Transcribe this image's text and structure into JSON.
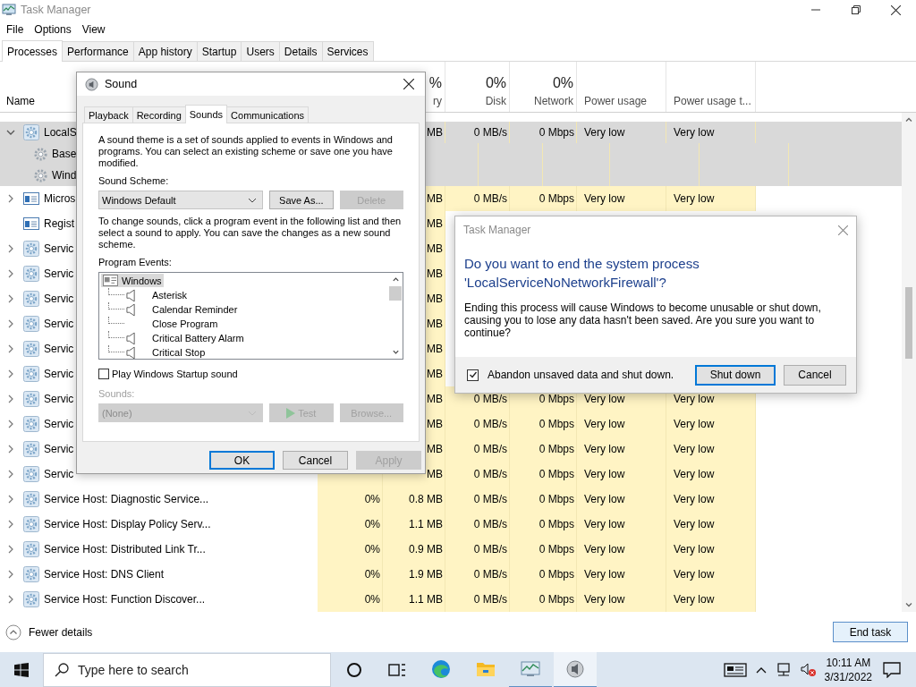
{
  "task_manager": {
    "title": "Task Manager",
    "menu": [
      "File",
      "Options",
      "View"
    ],
    "tabs": [
      {
        "label": "Processes",
        "selected": true
      },
      {
        "label": "Performance",
        "selected": false
      },
      {
        "label": "App history",
        "selected": false
      },
      {
        "label": "Startup",
        "selected": false
      },
      {
        "label": "Users",
        "selected": false
      },
      {
        "label": "Details",
        "selected": false
      },
      {
        "label": "Services",
        "selected": false
      }
    ],
    "columns": {
      "name": {
        "label": "Name"
      },
      "memory": {
        "percent": "%",
        "label": "ry"
      },
      "disk": {
        "percent": "0%",
        "label": "Disk"
      },
      "network": {
        "percent": "0%",
        "label": "Network"
      },
      "power": {
        "label": "Power usage"
      },
      "power_trend": {
        "label": "Power usage t..."
      }
    },
    "rows": [
      {
        "name": "LocalS",
        "expandable": true,
        "expanded": true,
        "kind": "service",
        "selected": true,
        "memory": "MB",
        "disk": "0 MB/s",
        "network": "0 Mbps",
        "power": "Very low",
        "power_trend": "Very low",
        "children": [
          {
            "name": "Base",
            "selected": false
          },
          {
            "name": "Wind",
            "selected": false
          }
        ]
      },
      {
        "name": "Micros",
        "expandable": true,
        "expanded": false,
        "kind": "app",
        "selected": false,
        "memory": "MB",
        "disk": "0 MB/s",
        "network": "0 Mbps",
        "power": "Very low",
        "power_trend": "Very low"
      },
      {
        "name": "Regist",
        "expandable": false,
        "kind": "app",
        "selected": false,
        "memory": "MB"
      },
      {
        "name": "Servic",
        "expandable": true,
        "expanded": false,
        "kind": "service",
        "selected": false,
        "memory": "MB"
      },
      {
        "name": "Servic",
        "expandable": true,
        "expanded": false,
        "kind": "service",
        "selected": false,
        "memory": "MB"
      },
      {
        "name": "Servic",
        "expandable": true,
        "expanded": false,
        "kind": "service",
        "selected": false,
        "memory": "MB"
      },
      {
        "name": "Servic",
        "expandable": true,
        "expanded": false,
        "kind": "service",
        "selected": false,
        "memory": "MB"
      },
      {
        "name": "Servic",
        "expandable": true,
        "expanded": false,
        "kind": "service",
        "selected": false,
        "memory": "MB"
      },
      {
        "name": "Servic",
        "expandable": true,
        "expanded": false,
        "kind": "service",
        "selected": false,
        "memory": "MB"
      },
      {
        "name": "Servic",
        "expandable": true,
        "expanded": false,
        "kind": "service",
        "selected": false,
        "memory": "MB",
        "disk": "0 MB/s",
        "network": "0 Mbps",
        "power": "Very low",
        "power_trend": "Very low"
      },
      {
        "name": "Servic",
        "expandable": true,
        "expanded": false,
        "kind": "service",
        "selected": false,
        "memory": "MB",
        "disk": "0 MB/s",
        "network": "0 Mbps",
        "power": "Very low",
        "power_trend": "Very low"
      },
      {
        "name": "Servic",
        "expandable": true,
        "expanded": false,
        "kind": "service",
        "selected": false,
        "memory": "MB",
        "disk": "0 MB/s",
        "network": "0 Mbps",
        "power": "Very low",
        "power_trend": "Very low"
      },
      {
        "name": "Servic",
        "expandable": true,
        "expanded": false,
        "kind": "service",
        "selected": false,
        "memory": "MB",
        "disk": "0 MB/s",
        "network": "0 Mbps",
        "power": "Very low",
        "power_trend": "Very low"
      },
      {
        "name": "Service Host: Diagnostic Service...",
        "expandable": true,
        "expanded": false,
        "kind": "service",
        "selected": false,
        "cpu": "0%",
        "memory": "0.8 MB",
        "disk": "0 MB/s",
        "network": "0 Mbps",
        "power": "Very low",
        "power_trend": "Very low"
      },
      {
        "name": "Service Host: Display Policy Serv...",
        "expandable": true,
        "expanded": false,
        "kind": "service",
        "selected": false,
        "cpu": "0%",
        "memory": "1.1 MB",
        "disk": "0 MB/s",
        "network": "0 Mbps",
        "power": "Very low",
        "power_trend": "Very low"
      },
      {
        "name": "Service Host: Distributed Link Tr...",
        "expandable": true,
        "expanded": false,
        "kind": "service",
        "selected": false,
        "cpu": "0%",
        "memory": "0.9 MB",
        "disk": "0 MB/s",
        "network": "0 Mbps",
        "power": "Very low",
        "power_trend": "Very low"
      },
      {
        "name": "Service Host: DNS Client",
        "expandable": true,
        "expanded": false,
        "kind": "service",
        "selected": false,
        "cpu": "0%",
        "memory": "1.9 MB",
        "disk": "0 MB/s",
        "network": "0 Mbps",
        "power": "Very low",
        "power_trend": "Very low"
      },
      {
        "name": "Service Host: Function Discover...",
        "expandable": true,
        "expanded": false,
        "kind": "service",
        "selected": false,
        "cpu": "0%",
        "memory": "1.1 MB",
        "disk": "0 MB/s",
        "network": "0 Mbps",
        "power": "Very low",
        "power_trend": "Very low"
      }
    ],
    "fewer_details": "Fewer details",
    "end_task": "End task"
  },
  "sound_dialog": {
    "title": "Sound",
    "tabs": [
      {
        "label": "Playback",
        "selected": false
      },
      {
        "label": "Recording",
        "selected": false
      },
      {
        "label": "Sounds",
        "selected": true
      },
      {
        "label": "Communications",
        "selected": false
      }
    ],
    "intro": "A sound theme is a set of sounds applied to events in Windows and programs. You can select an existing scheme or save one you have modified.",
    "scheme_label": "Sound Scheme:",
    "scheme_value": "Windows Default",
    "save_as": {
      "label": "Save As...",
      "disabled": false
    },
    "delete": {
      "label": "Delete",
      "disabled": true
    },
    "instructions": "To change sounds, click a program event in the following list and then select a sound to apply. You can save the changes as a new sound scheme.",
    "events_label": "Program Events:",
    "events": [
      {
        "name": "Windows",
        "selected": true,
        "children": [
          {
            "name": "Asterisk",
            "has_sound": true,
            "selected": false
          },
          {
            "name": "Calendar Reminder",
            "has_sound": true,
            "selected": false
          },
          {
            "name": "Close Program",
            "has_sound": false,
            "selected": false
          },
          {
            "name": "Critical Battery Alarm",
            "has_sound": true,
            "selected": false
          },
          {
            "name": "Critical Stop",
            "has_sound": true,
            "selected": false
          }
        ]
      }
    ],
    "startup_sound": {
      "label": "Play Windows Startup sound",
      "checked": false
    },
    "sounds": {
      "label": "Sounds:",
      "value": "(None)",
      "disabled": true
    },
    "test": {
      "label": "Test",
      "disabled": true
    },
    "browse": {
      "label": "Browse...",
      "disabled": true
    },
    "buttons": [
      {
        "label": "OK",
        "default": true,
        "disabled": false
      },
      {
        "label": "Cancel",
        "default": false,
        "disabled": false
      },
      {
        "label": "Apply",
        "default": false,
        "disabled": true
      }
    ]
  },
  "confirm_dialog": {
    "title": "Task Manager",
    "heading": "Do you want to end the system process 'LocalServiceNoNetworkFirewall'?",
    "body": "Ending this process will cause Windows to become unusable or shut down, causing you to lose any data hasn't been saved. Are you sure you want to continue?",
    "abandon": {
      "label": "Abandon unsaved data and shut down.",
      "checked": true
    },
    "buttons": [
      {
        "label": "Shut down",
        "default": true
      },
      {
        "label": "Cancel",
        "default": false
      }
    ]
  },
  "taskbar": {
    "search_placeholder": "Type here to search",
    "apps": [
      {
        "kind": "edge",
        "running": false,
        "selected": false
      },
      {
        "kind": "explorer",
        "running": false,
        "selected": false
      },
      {
        "kind": "task-manager",
        "running": true,
        "selected": false
      },
      {
        "kind": "sound",
        "running": true,
        "selected": true
      }
    ],
    "time": "10:11 AM",
    "date": "3/31/2022"
  }
}
